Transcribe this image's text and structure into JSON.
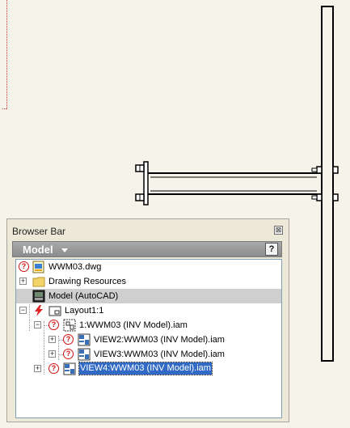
{
  "panel": {
    "title": "Browser Bar",
    "close_glyph": "⊠",
    "model_menu": "Model",
    "help_glyph": "?"
  },
  "tree": {
    "rows": [
      {
        "label": "WWM03.dwg",
        "icon": "dwg-file-icon",
        "status": "question-icon"
      },
      {
        "label": "Drawing Resources",
        "icon": "folder-icon",
        "expander": "+"
      },
      {
        "label": "Model (AutoCAD)",
        "icon": "model-space-icon"
      },
      {
        "label": "Layout1:1",
        "icon": "layout-icon",
        "status": "lightning-icon",
        "expander": "−"
      },
      {
        "label": "1:WWM03 (INV Model).iam",
        "icon": "view-frame-icon",
        "status": "question-icon",
        "expander": "−"
      },
      {
        "label": "VIEW2:WWM03 (INV Model).iam",
        "icon": "view-icon",
        "status": "question-icon",
        "expander": "+"
      },
      {
        "label": "VIEW3:WWM03 (INV Model).iam",
        "icon": "view-icon",
        "status": "question-icon",
        "expander": "+"
      },
      {
        "label": "VIEW4:WWM03 (INV Model).iam",
        "icon": "view-icon",
        "status": "question-icon",
        "expander": "+",
        "selected": true
      }
    ]
  },
  "colors": {
    "background": "#f5f3ea",
    "selection": "#316ac5",
    "status_red": "#d01010"
  }
}
